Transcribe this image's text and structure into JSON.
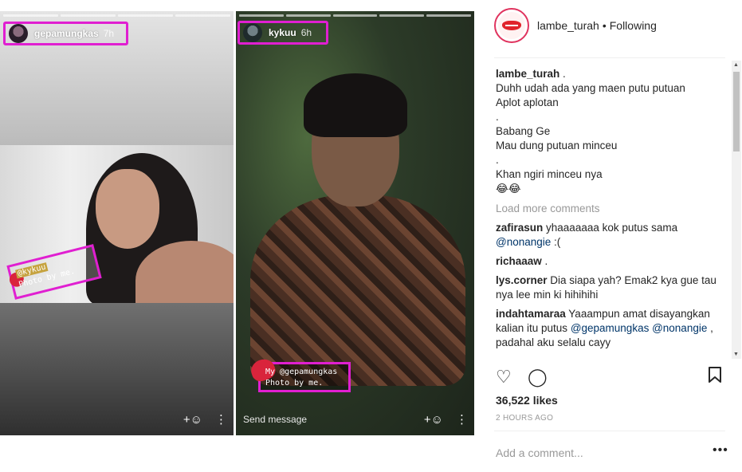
{
  "stories": {
    "left": {
      "username": "gepamungkas",
      "time": "7h",
      "sticker_tag": "@kykuu",
      "sticker_caption": "Photo by me."
    },
    "right": {
      "username": "kykuu",
      "time": "6h",
      "sticker_line1": "My @gepamungkas",
      "sticker_line2": "Photo by me.",
      "send_message": "Send message"
    }
  },
  "post": {
    "account": "lambe_turah",
    "dot": "•",
    "follow_status": "Following",
    "caption_user": "lambe_turah",
    "caption_lines": [
      " .",
      "Duhh udah ada yang maen putu putuan",
      "Aplot aplotan",
      ".",
      "Babang Ge",
      "Mau dung putuan minceu",
      ".",
      "Khan ngiri minceu nya",
      "😂😂"
    ],
    "load_more": "Load more comments",
    "comments": [
      {
        "user": "zafirasun",
        "text": " yhaaaaaaa kok putus sama ",
        "mention": "@nonangie",
        "after": " :("
      },
      {
        "user": "richaaaw",
        "text": " .",
        "mention": "",
        "after": ""
      },
      {
        "user": "lys.corner",
        "text": " Dia siapa yah? Emak2 kya gue tau nya lee min ki hihihihi",
        "mention": "",
        "after": ""
      },
      {
        "user": "indahtamaraa",
        "text": " Yaaampun amat disayangkan kalian itu putus ",
        "mention": "@gepamungkas @nonangie",
        "after": " , padahal aku selalu cayy"
      }
    ],
    "likes": "36,522 likes",
    "posted": "2 HOURS AGO",
    "comment_placeholder": "Add a comment...",
    "more": "•••"
  },
  "icons": {
    "like": "heart-icon",
    "comment": "comment-bubble-icon",
    "save": "bookmark-icon",
    "add_person": "add-person-icon",
    "more_vertical": "more-vertical-icon"
  },
  "colors": {
    "highlight": "#e01fd1",
    "mention": "#003569",
    "muted": "#999999",
    "text": "#262626"
  }
}
